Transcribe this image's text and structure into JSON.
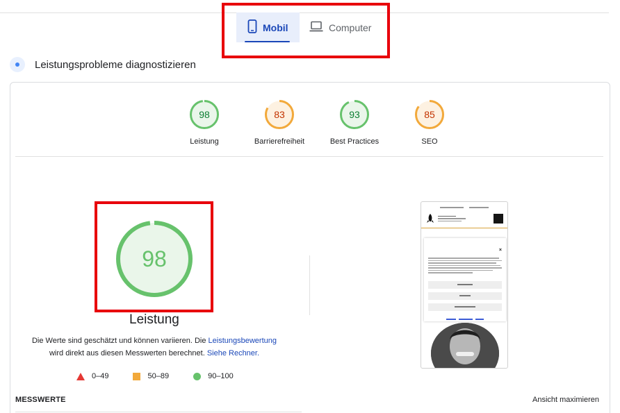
{
  "tabs": [
    {
      "label": "Mobil",
      "icon": "smartphone-icon",
      "active": true
    },
    {
      "label": "Computer",
      "icon": "laptop-icon",
      "active": false
    }
  ],
  "section": {
    "title": "Leistungsprobleme diagnostizieren"
  },
  "colors": {
    "good": "#0c7e32",
    "good_ring": "#67c26c",
    "average": "#c33300",
    "average_ring": "#f2a93b",
    "poor": "#e53935",
    "accent": "#1a47b8",
    "highlight": "#e8000b"
  },
  "scores": [
    {
      "label": "Leistung",
      "value": 98,
      "rating": "good"
    },
    {
      "label": "Barrierefreiheit",
      "value": 83,
      "rating": "average"
    },
    {
      "label": "Best Practices",
      "value": 93,
      "rating": "good"
    },
    {
      "label": "SEO",
      "value": 85,
      "rating": "average"
    }
  ],
  "performance": {
    "score": 98,
    "label": "Leistung",
    "desc_part1": "Die Werte sind geschätzt und können variieren. Die ",
    "desc_link1": "Leistungsbewertung",
    "desc_part2": "wird direkt aus diesen Messwerten berechnet. ",
    "desc_link2": "Siehe Rechner."
  },
  "legend": [
    {
      "range": "0–49",
      "shape": "triangle"
    },
    {
      "range": "50–89",
      "shape": "square"
    },
    {
      "range": "90–100",
      "shape": "circle"
    }
  ],
  "footer": {
    "metrics_label": "MESSWERTE",
    "expand_label": "Ansicht maximieren"
  }
}
